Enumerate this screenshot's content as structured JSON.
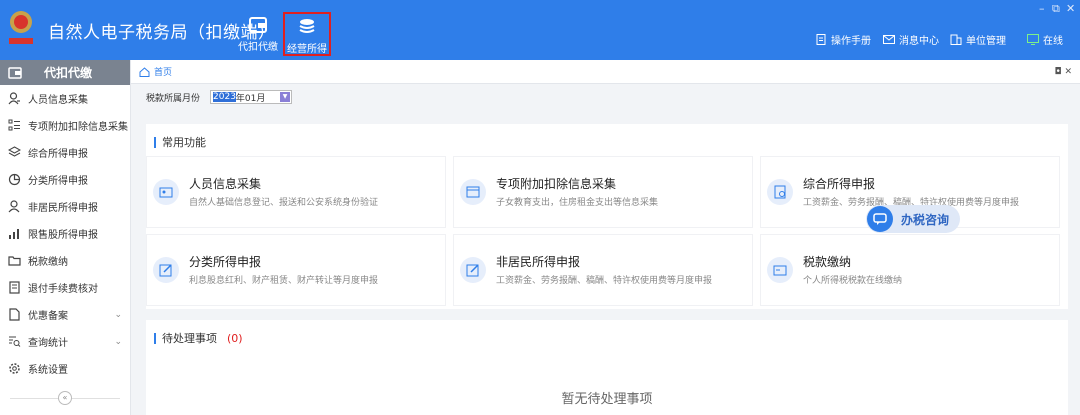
{
  "header": {
    "title": "自然人电子税务局（扣缴端）",
    "nav": [
      {
        "label": "代扣代缴",
        "icon": "wallet-icon"
      },
      {
        "label": "经营所得",
        "icon": "coin-stack-icon"
      }
    ],
    "window_controls": {
      "minimize": "–",
      "restore": "⧉",
      "close": "✕"
    },
    "links": [
      {
        "label": "操作手册",
        "icon": "manual-icon"
      },
      {
        "label": "消息中心",
        "icon": "mail-icon"
      },
      {
        "label": "单位管理",
        "icon": "building-icon"
      },
      {
        "label": "在线",
        "icon": "monitor-icon"
      }
    ]
  },
  "sidebar": {
    "title": "代扣代缴",
    "items": [
      {
        "label": "人员信息采集",
        "icon": "person-icon"
      },
      {
        "label": "专项附加扣除信息采集",
        "icon": "list-icon"
      },
      {
        "label": "综合所得申报",
        "icon": "layers-icon"
      },
      {
        "label": "分类所得申报",
        "icon": "pie-icon"
      },
      {
        "label": "非居民所得申报",
        "icon": "user-icon"
      },
      {
        "label": "限售股所得申报",
        "icon": "bar-chart-icon"
      },
      {
        "label": "税款缴纳",
        "icon": "folder-icon"
      },
      {
        "label": "退付手续费核对",
        "icon": "doc-icon"
      },
      {
        "label": "优惠备案",
        "icon": "file-icon",
        "expand": "⌄"
      },
      {
        "label": "查询统计",
        "icon": "search-list-icon",
        "expand": "⌄"
      },
      {
        "label": "系统设置",
        "icon": "gear-icon"
      }
    ],
    "collapse": "«"
  },
  "breadcrumb": {
    "home": "首页",
    "controls": "◘ ✕"
  },
  "period": {
    "label": "税款所属月份",
    "value_selected": "2023",
    "value_rest": "年01月"
  },
  "functions": {
    "title": "常用功能",
    "tiles": [
      {
        "title": "人员信息采集",
        "desc": "自然人基础信息登记、报送和公安系统身份验证"
      },
      {
        "title": "专项附加扣除信息采集",
        "desc": "子女教育支出，住房租金支出等信息采集"
      },
      {
        "title": "综合所得申报",
        "desc": "工资薪金、劳务报酬、稿酬、特许权使用费等月度申报"
      },
      {
        "title": "分类所得申报",
        "desc": "利息股息红利、财产租赁、财产转让等月度申报"
      },
      {
        "title": "非居民所得申报",
        "desc": "工资薪金、劳务报酬、稿酬、特许权使用费等月度申报"
      },
      {
        "title": "税款缴纳",
        "desc": "个人所得税税款在线缴纳"
      }
    ]
  },
  "consult": {
    "label": "办税咨询"
  },
  "pending": {
    "title": "待处理事项",
    "count": "(0)",
    "empty": "暂无待处理事项"
  }
}
